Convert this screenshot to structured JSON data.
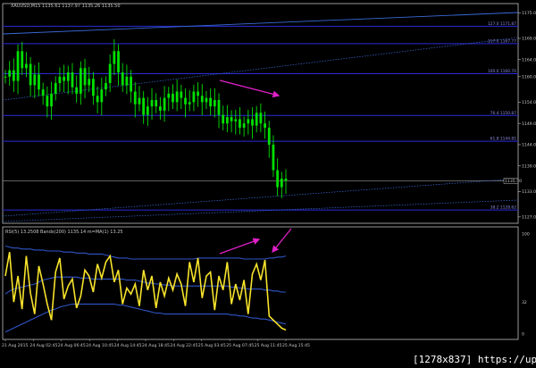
{
  "header": {
    "symbol_text": "XAUUSD,M15 1135.61 1137.97 1135.26 1135.50"
  },
  "colors": {
    "background": "#000000",
    "price_candles": "#00e000",
    "fib_levels": "#2b2bd8",
    "channel_lines": "#3a6ad8",
    "rsi_line": "#f7e32b",
    "bollinger": "#2f55c8",
    "divergence_arrows": "#e020c8",
    "grid": "#ffffff"
  },
  "chart_data": [
    {
      "type": "line",
      "panel": "price",
      "x_axis_labels": [
        "21 Aug 2015",
        "24 Aug 02:45",
        "24 Aug 06:45",
        "24 Aug 10:45",
        "24 Aug 14:45",
        "24 Aug 18:45",
        "24 Aug 22:45",
        "25 Aug 03:45",
        "25 Aug 07:45",
        "25 Aug 11:45",
        "25 Aug 15:45"
      ],
      "y_ticks": [
        1175.0,
        1169.0,
        1164.0,
        1160.0,
        1154.0,
        1149.0,
        1144.0,
        1139.0,
        1133.0,
        1127.0
      ],
      "ylim": [
        1125.5,
        1177.2
      ],
      "last_price": 1135.5,
      "last_price_label": "1135.50",
      "fib_levels": [
        {
          "label": "127.0 1171.87",
          "value": 1171.87
        },
        {
          "label": "117.0 1167.77",
          "value": 1167.77
        },
        {
          "label": "100.0 1160.70",
          "value": 1160.7
        },
        {
          "label": "76.4 1150.87",
          "value": 1150.87
        },
        {
          "label": "61.8 1144.81",
          "value": 1144.81
        },
        {
          "label": "38.2 1128.62",
          "value": 1128.62
        }
      ],
      "series": [
        {
          "values": [
            1160.0,
            1161.5,
            1159.0,
            1166.0,
            1162.0,
            1163.0,
            1158.0,
            1160.5,
            1157.0,
            1155.5,
            1153.0,
            1156.0,
            1158.5,
            1160.0,
            1159.0,
            1161.0,
            1157.5,
            1156.0,
            1162.0,
            1158.0,
            1159.5,
            1155.5,
            1154.0,
            1157.0,
            1158.5,
            1163.0,
            1166.0,
            1161.0,
            1158.0,
            1160.0,
            1156.5,
            1153.5,
            1155.0,
            1151.0,
            1153.0,
            1154.5,
            1153.0,
            1152.0,
            1155.0,
            1156.0,
            1154.0,
            1156.5,
            1155.0,
            1153.5,
            1154.0,
            1156.5,
            1155.5,
            1154.0,
            1155.0,
            1153.0,
            1154.5,
            1151.0,
            1149.0,
            1150.5,
            1149.5,
            1150.0,
            1148.0,
            1149.0,
            1150.0,
            1148.5,
            1151.5,
            1149.0,
            1148.0,
            1144.0,
            1138.0,
            1134.0,
            1136.0,
            1135.5
          ]
        }
      ]
    },
    {
      "type": "line",
      "panel": "oscillator",
      "title": "RSI(5) 13.2508  Bands(200) 1135.14 m=MA(1) 13.25",
      "ylim": [
        0,
        100
      ],
      "y_ticks": [
        {
          "label": "100",
          "value": 100
        },
        {
          "label": "32",
          "value": 32
        },
        {
          "label": "0",
          "value": 0
        }
      ],
      "series": [
        {
          "values": [
            58,
            82,
            32,
            58,
            25,
            78,
            41,
            20,
            68,
            50,
            30,
            14,
            62,
            76,
            35,
            48,
            55,
            26,
            38,
            64,
            58,
            42,
            70,
            56,
            72,
            78,
            52,
            64,
            30,
            46,
            40,
            50,
            28,
            64,
            44,
            58,
            26,
            52,
            38,
            56,
            44,
            60,
            50,
            28,
            72,
            52,
            76,
            36,
            58,
            62,
            24,
            58,
            44,
            72,
            30,
            50,
            34,
            54,
            20,
            60,
            70,
            54,
            74,
            18,
            14,
            10,
            6,
            4
          ]
        },
        {
          "values": [
            88,
            87,
            86,
            86,
            85,
            85,
            85,
            84,
            84,
            84,
            83,
            83,
            83,
            83,
            82,
            82,
            82,
            81,
            81,
            81,
            80,
            80,
            80,
            80,
            79,
            78,
            77,
            76,
            76,
            76,
            75,
            75,
            75,
            75,
            75,
            75,
            75,
            75,
            75,
            75,
            75,
            75,
            75,
            75,
            75,
            75,
            76,
            76,
            76,
            76,
            76,
            76,
            76,
            76,
            76,
            76,
            76,
            75,
            75,
            75,
            75,
            75,
            75,
            76,
            76,
            77,
            77,
            78
          ]
        },
        {
          "values": [
            40,
            43,
            45,
            46,
            47,
            48,
            49,
            50,
            52,
            54,
            55,
            56,
            57,
            57,
            57,
            57,
            57,
            57,
            56,
            56,
            56,
            55,
            55,
            55,
            55,
            55,
            55,
            55,
            55,
            54,
            54,
            54,
            53,
            52,
            51,
            51,
            50,
            50,
            49,
            49,
            48,
            48,
            48,
            48,
            48,
            48,
            48,
            48,
            48,
            48,
            48,
            48,
            48,
            48,
            47,
            47,
            46,
            46,
            45,
            45,
            45,
            45,
            44,
            44,
            43,
            43,
            42,
            42
          ]
        },
        {
          "values": [
            2,
            4,
            6,
            8,
            10,
            12,
            14,
            16,
            18,
            20,
            22,
            24,
            25,
            27,
            28,
            29,
            30,
            30,
            30,
            30,
            30,
            30,
            30,
            30,
            30,
            30,
            30,
            29,
            29,
            28,
            27,
            26,
            25,
            24,
            23,
            22,
            21,
            21,
            20,
            20,
            20,
            20,
            20,
            20,
            20,
            20,
            20,
            20,
            20,
            20,
            20,
            20,
            20,
            20,
            19,
            19,
            18,
            18,
            17,
            16,
            16,
            15,
            15,
            14,
            13,
            12,
            11,
            10
          ]
        }
      ]
    }
  ],
  "watermark": {
    "text": "[1278x837] https://upic.me/"
  }
}
